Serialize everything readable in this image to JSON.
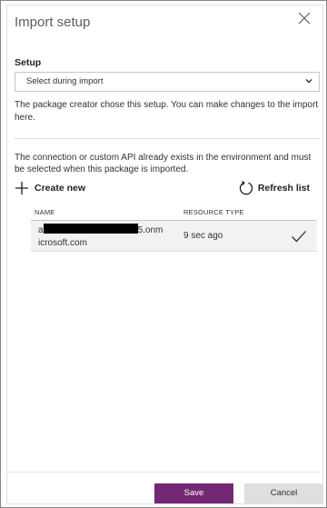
{
  "panel": {
    "title": "Import setup",
    "close_icon": "close-icon"
  },
  "setup": {
    "label": "Setup",
    "selected_option": "Select during import",
    "chevron_icon": "chevron-down-icon",
    "note": "The package creator chose this setup. You can make changes to the import here."
  },
  "connections": {
    "note": "The connection or custom API already exists in the environment and must be selected when this package is imported.",
    "create_new_label": "Create new",
    "create_new_icon": "plus-icon",
    "refresh_label": "Refresh list",
    "refresh_icon": "refresh-icon",
    "columns": [
      "NAME",
      "RESOURCE TYPE"
    ],
    "rows": [
      {
        "name_prefix": "a",
        "name_suffix": "5.onm",
        "name_line2": "icrosoft.com",
        "resource_type": "9 sec ago",
        "selected": true,
        "check_icon": "checkmark-icon"
      }
    ]
  },
  "footer": {
    "save_label": "Save",
    "cancel_label": "Cancel"
  },
  "colors": {
    "accent": "#742774",
    "row_selected_bg": "#f3f2f1",
    "cancel_bg": "#e1dfdd"
  }
}
